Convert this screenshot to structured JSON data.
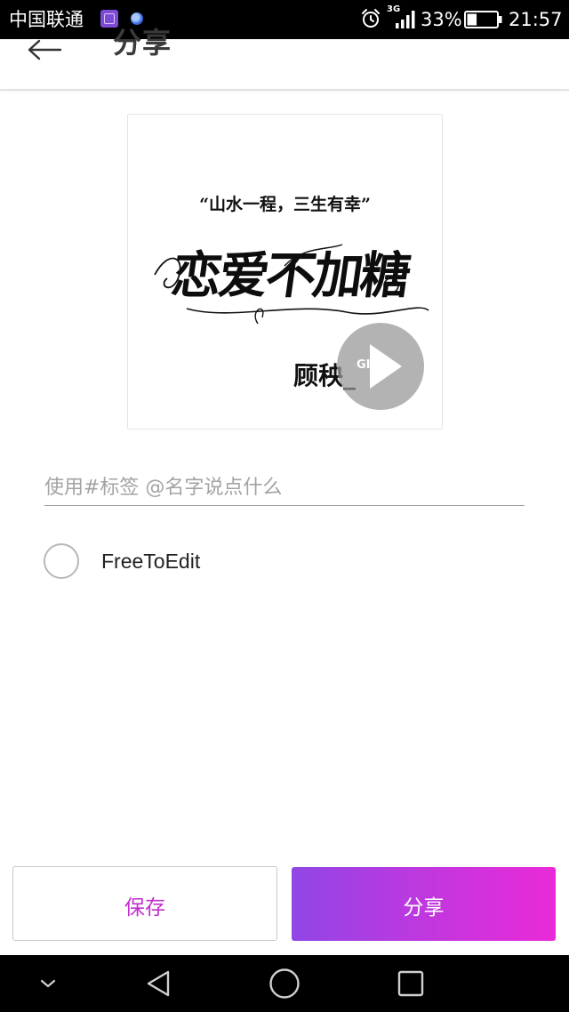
{
  "status_bar": {
    "carrier": "中国联通",
    "network_type": "3G",
    "battery_percent": "33%",
    "battery_level": 0.33,
    "time": "21:57",
    "icons": [
      "gallery-notification-icon",
      "app-notification-icon",
      "alarm-icon",
      "signal-icon",
      "battery-icon"
    ]
  },
  "app_bar": {
    "back_icon": "arrow-left-icon",
    "title": "分享"
  },
  "preview": {
    "quote": "“山水一程，三生有幸”",
    "calligraphy": "恋爱不加糖",
    "author": "顾秧_",
    "media_badge": "GIF",
    "play_icon": "play-icon"
  },
  "caption": {
    "placeholder": "使用#标签 @名字说点什么",
    "value": ""
  },
  "freetoedit": {
    "label": "FreeToEdit",
    "checked": false
  },
  "actions": {
    "save_label": "保存",
    "share_label": "分享",
    "accent_color": "#c42fcf",
    "share_gradient": [
      "#9046e6",
      "#ea2ad8"
    ]
  },
  "nav_bar": {
    "icons": [
      "collapse-chevron-icon",
      "back-triangle-icon",
      "home-circle-icon",
      "recents-square-icon"
    ]
  }
}
